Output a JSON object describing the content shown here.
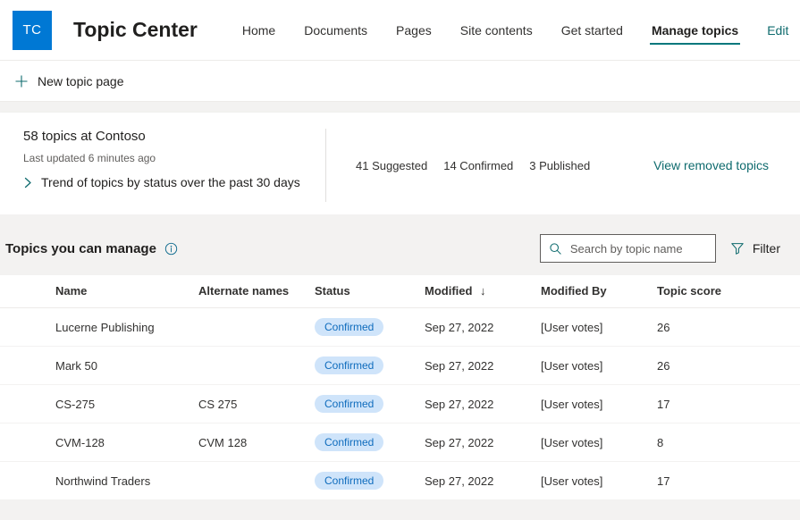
{
  "header": {
    "logo_text": "TC",
    "logo_color": "#0078d4",
    "site_title": "Topic Center",
    "nav": [
      {
        "label": "Home",
        "active": false,
        "link": false
      },
      {
        "label": "Documents",
        "active": false,
        "link": false
      },
      {
        "label": "Pages",
        "active": false,
        "link": false
      },
      {
        "label": "Site contents",
        "active": false,
        "link": false
      },
      {
        "label": "Get started",
        "active": false,
        "link": false
      },
      {
        "label": "Manage topics",
        "active": true,
        "link": false
      },
      {
        "label": "Edit",
        "active": false,
        "link": true
      }
    ],
    "accent_color": "#03787c"
  },
  "command_bar": {
    "new_topic_page_label": "New topic page",
    "plus_icon": "plus-icon"
  },
  "summary": {
    "title": "58 topics at Contoso",
    "subtitle": "Last updated 6 minutes ago",
    "trend_label": "Trend of topics by status over the past 30 days",
    "stats": [
      {
        "label": "41 Suggested"
      },
      {
        "label": "14 Confirmed"
      },
      {
        "label": "3 Published"
      }
    ],
    "removed_link": "View removed topics",
    "link_color": "#0f6b6e"
  },
  "list": {
    "title": "Topics you can manage",
    "info_icon": "info-icon",
    "search": {
      "placeholder": "Search by topic name",
      "value": "",
      "icon": "search-icon"
    },
    "filter": {
      "label": "Filter",
      "icon": "filter-icon"
    },
    "columns": [
      "Name",
      "Alternate names",
      "Status",
      "Modified",
      "Modified By",
      "Topic score"
    ],
    "sort": {
      "column": "Modified",
      "direction_glyph": "↓"
    },
    "rows": [
      {
        "name": "Lucerne Publishing",
        "alternate": "",
        "status": "Confirmed",
        "modified": "Sep 27, 2022",
        "modified_by": "[User votes]",
        "score": "26"
      },
      {
        "name": "Mark 50",
        "alternate": "",
        "status": "Confirmed",
        "modified": "Sep 27, 2022",
        "modified_by": "[User votes]",
        "score": "26"
      },
      {
        "name": "CS-275",
        "alternate": "CS 275",
        "status": "Confirmed",
        "modified": "Sep 27, 2022",
        "modified_by": "[User votes]",
        "score": "17"
      },
      {
        "name": "CVM-128",
        "alternate": "CVM 128",
        "status": "Confirmed",
        "modified": "Sep 27, 2022",
        "modified_by": "[User votes]",
        "score": "8"
      },
      {
        "name": "Northwind Traders",
        "alternate": "",
        "status": "Confirmed",
        "modified": "Sep 27, 2022",
        "modified_by": "[User votes]",
        "score": "17"
      }
    ],
    "badge_bg": "#cfe4fa",
    "badge_fg": "#0f6cbd"
  }
}
